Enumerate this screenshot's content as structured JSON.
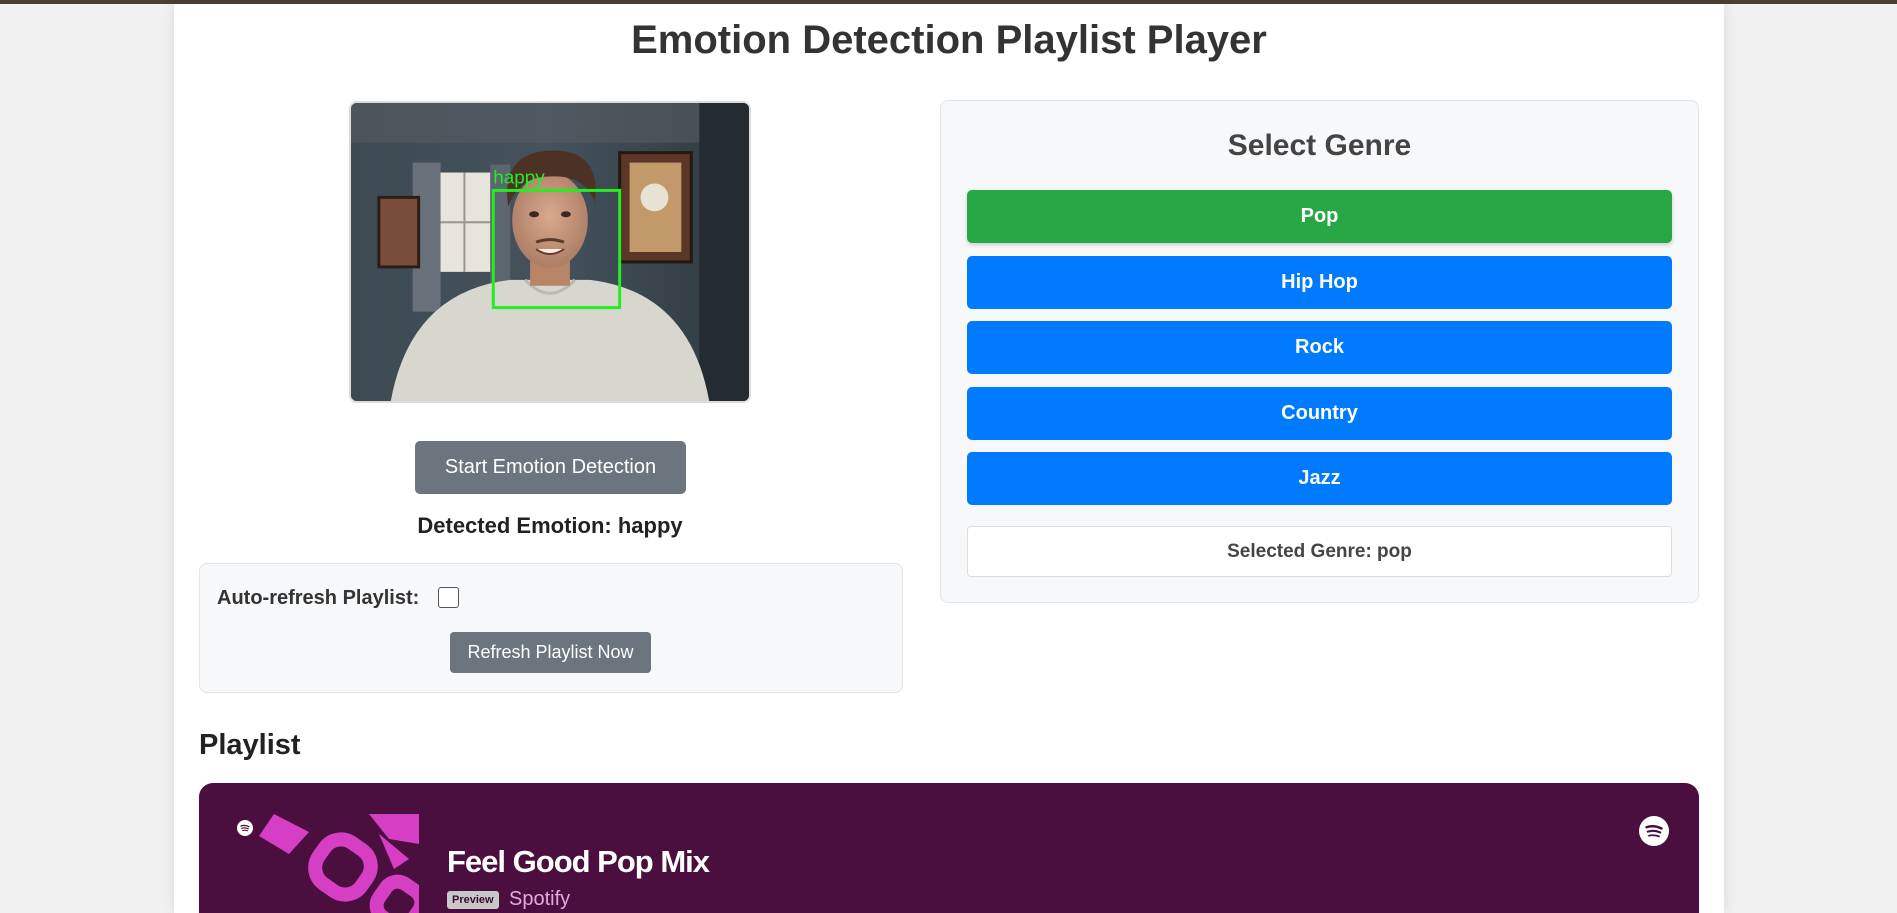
{
  "page": {
    "title": "Emotion Detection Playlist Player"
  },
  "camera": {
    "face_label": "happy"
  },
  "detection": {
    "start_button": "Start Emotion Detection",
    "detected_text": "Detected Emotion: happy"
  },
  "refresh": {
    "auto_label": "Auto-refresh Playlist:",
    "auto_checked": false,
    "refresh_button": "Refresh Playlist Now"
  },
  "genre": {
    "title": "Select Genre",
    "buttons": [
      {
        "label": "Pop",
        "active": true
      },
      {
        "label": "Hip Hop",
        "active": false
      },
      {
        "label": "Rock",
        "active": false
      },
      {
        "label": "Country",
        "active": false
      },
      {
        "label": "Jazz",
        "active": false
      }
    ],
    "selected_text": "Selected Genre: pop"
  },
  "playlist": {
    "heading": "Playlist",
    "embed": {
      "title": "Feel Good Pop Mix",
      "badge": "Preview",
      "provider": "Spotify"
    }
  },
  "colors": {
    "active_genre": "#28a745",
    "genre_button": "#007bff",
    "secondary_button": "#6c757d",
    "spotify_bg": "#4a0f3f",
    "face_box": "#22ee22"
  },
  "icons": [
    "spotify-icon",
    "checkbox"
  ]
}
